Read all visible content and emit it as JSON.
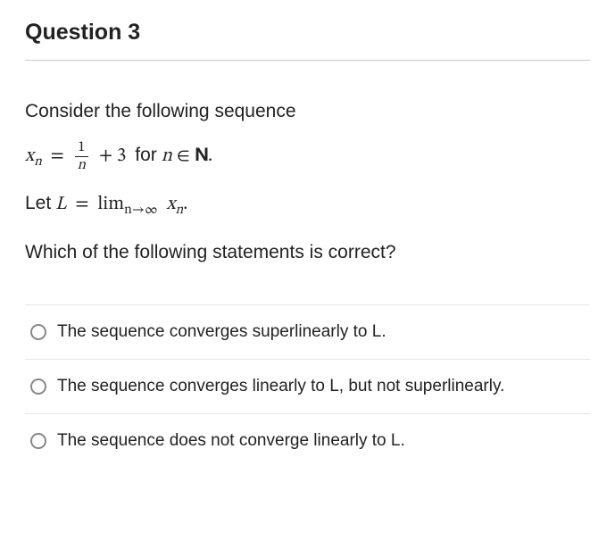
{
  "question": {
    "title": "Question 3",
    "intro": "Consider the following sequence",
    "formula_plain": "x_n = 1/n + 3  for n ∈ ℕ.",
    "let_line_plain": "Let L = lim_{n→∞} x_n.",
    "prompt": "Which of the following statements is correct?",
    "formula_parts": {
      "x": "x",
      "sub_n": "n",
      "eq": "=",
      "frac_num": "1",
      "frac_den": "n",
      "plus3": "+ 3",
      "for": "for",
      "n": "n",
      "in": "∈",
      "N": "N",
      "period": "."
    },
    "let_parts": {
      "Let": "Let",
      "L": "L",
      "eq": "=",
      "lim": "lim",
      "sub": "n→∞",
      "x": "x",
      "xn": "n",
      "period": "."
    }
  },
  "options": [
    {
      "label": "The sequence converges superlinearly to L."
    },
    {
      "label": "The sequence converges linearly to L, but not superlinearly."
    },
    {
      "label": "The sequence does not converge linearly to L."
    }
  ]
}
